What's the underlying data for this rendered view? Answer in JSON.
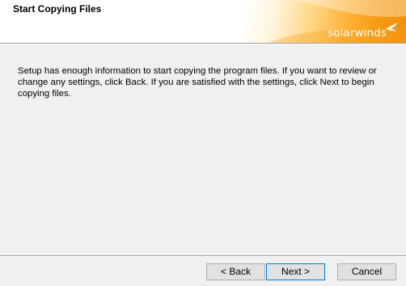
{
  "header": {
    "title": "Start Copying Files",
    "logo_text": "solarwinds",
    "logo_mark": "®"
  },
  "body": {
    "message": "Setup has enough information to start copying the program files.  If you want to review or change any settings, click Back.  If you are satisfied with the settings, click Next to begin copying files."
  },
  "buttons": {
    "back": "< Back",
    "next": "Next >",
    "cancel": "Cancel"
  },
  "colors": {
    "accent_orange": "#f28c0a",
    "focus_border": "#0078d7",
    "background": "#f0f0f0"
  }
}
